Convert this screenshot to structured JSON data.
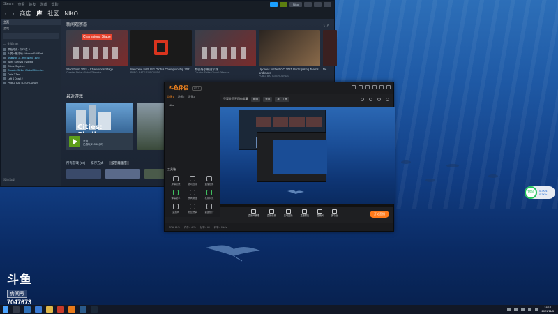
{
  "steam": {
    "menu_items": [
      "Steam",
      "查看",
      "好友",
      "游戏",
      "帮助"
    ],
    "nav": {
      "store": "商店",
      "library": "库",
      "community": "社区",
      "user": "NIKO"
    },
    "user_badge": "Niko",
    "sidebar": {
      "home_label": "主页",
      "filter_label": "游戏",
      "section_label": "— 全部 (36)",
      "games": [
        {
          "name": "原始传说：初中生 4",
          "running": false
        },
        {
          "name": "人类一败涂地 / Human Fall Flat",
          "running": false
        },
        {
          "name": "全境封锁 2 - 纽约军阀扩展包",
          "running": true
        },
        {
          "name": "ARK: Survival Evolved",
          "running": false
        },
        {
          "name": "Cities: Skylines",
          "running": false
        },
        {
          "name": "Counter-Strike: Global Offensive",
          "running": true
        },
        {
          "name": "Dota 2 Test",
          "running": false
        },
        {
          "name": "Left 4 Dead 2",
          "running": false
        },
        {
          "name": "PUBG: BATTLEGROUNDS",
          "running": true
        }
      ],
      "add_game": "添加游戏"
    },
    "news_title": "新闻观察器",
    "news": [
      {
        "tag": "Champions Stage",
        "title": "Stockholm 2021 - Champions Stage",
        "source": "Counter-Strike: Global Offensive",
        "accent": "#e8442f"
      },
      {
        "tag": "PUBG",
        "title": "Welcome to PUBG Global Championship 2021",
        "source": "PUBG: BATTLEGROUNDS",
        "accent": "#d9341e"
      },
      {
        "tag": "",
        "title": "斯德哥尔摩冠军赛",
        "source": "Counter-Strike: Global Offensive",
        "accent": "#e8442f"
      },
      {
        "tag": "",
        "title": "Updates to the PGC 2021 Participating Teams and more",
        "source": "PUBG: BATTLEGROUNDS",
        "accent": "#b8894a"
      },
      {
        "tag": "",
        "title": "Ne",
        "source": "",
        "accent": "#444"
      }
    ],
    "recent_title": "最近游戏",
    "recent": [
      {
        "title": "Cities: Skylines",
        "status": "已游玩 213.6 小时",
        "play": "开始"
      },
      {
        "title": "ARK",
        "status": "",
        "play": ""
      }
    ],
    "all_games_title": "所有游戏 (36)",
    "sort_label": "排序方式",
    "sort_value": "按字母顺序"
  },
  "douyu": {
    "logo": "斗鱼伴侣",
    "version": "V3.5",
    "left_tabs": [
      "场景1",
      "场景2",
      "场景3"
    ],
    "scene": "Niko",
    "tools_title": "工具箱",
    "tools": [
      "屏幕滤镜",
      "游戏音效",
      "直播投屏",
      "弹幕助手",
      "房间管理",
      "礼物特效",
      "直播间",
      "粉丝榜单",
      "数据统计",
      "弹幕姬",
      "抽奖",
      "更多"
    ],
    "preview_top": {
      "channel": "只要全员开团你就赢",
      "chip1": "横屏",
      "chip2": "竖屏",
      "chip3": "推广工具"
    },
    "bottom_buttons": [
      "直播间管理",
      "直播设置",
      "互动直播",
      "直播预告",
      "直播间",
      "多平台",
      "直播设置"
    ],
    "live_button": "开始直播",
    "status": [
      "CPU: 21%",
      "内存：42%",
      "帧率：60",
      "码率：0kb/s"
    ]
  },
  "watermark": {
    "logo": "斗鱼",
    "room_label": "房间号",
    "room_number": "7047673"
  },
  "widget": {
    "percent": "19%",
    "line1": "0.3K/s",
    "line2": "0.3K/s"
  },
  "taskbar": {
    "time": "18:17",
    "date": "2021/11/3"
  }
}
